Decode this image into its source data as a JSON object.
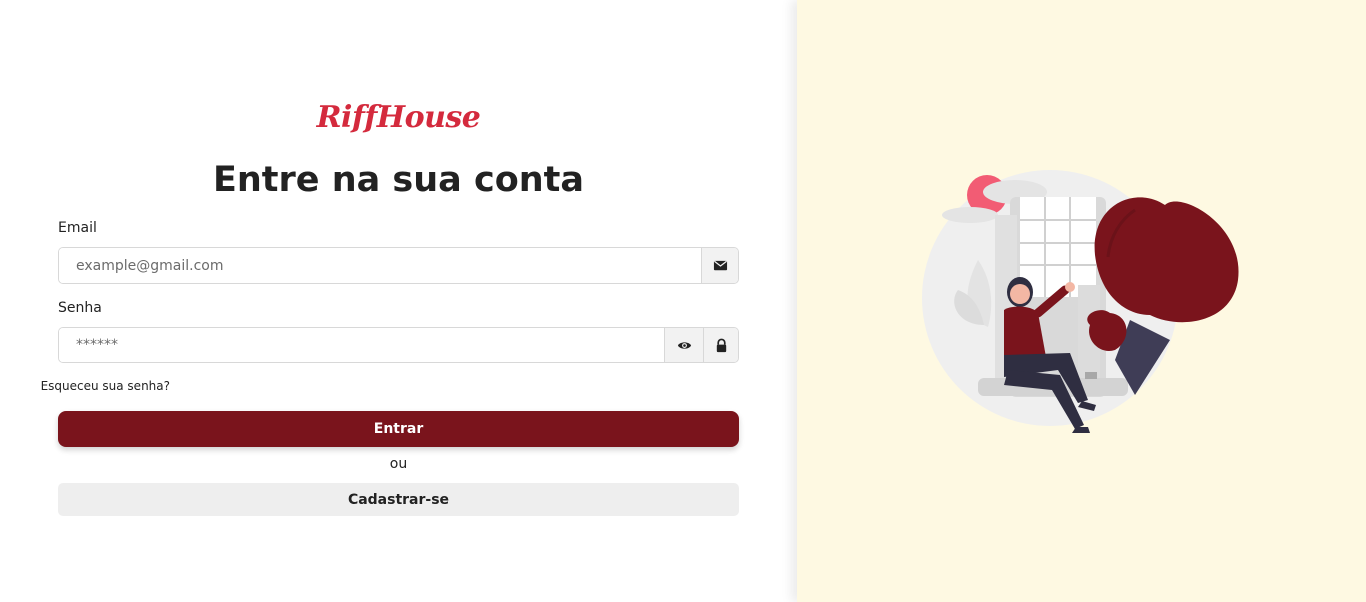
{
  "brand": {
    "logo_text": "RiffHouse",
    "color": "#d42a3d"
  },
  "login": {
    "title": "Entre na sua conta",
    "email_label": "Email",
    "email_placeholder": "example@gmail.com",
    "password_label": "Senha",
    "password_placeholder": "******",
    "forgot_link": "Esqueceu sua senha?",
    "submit_label": "Entrar",
    "divider_text": "ou",
    "register_label": "Cadastrar-se"
  },
  "icons": {
    "email": "envelope-icon",
    "show_password": "eye-icon",
    "password": "lock-icon"
  },
  "colors": {
    "primary": "#7a141c",
    "right_panel_bg": "#fef9e2",
    "illustration_accent": "#7a141c",
    "sun": "#f25c74"
  }
}
